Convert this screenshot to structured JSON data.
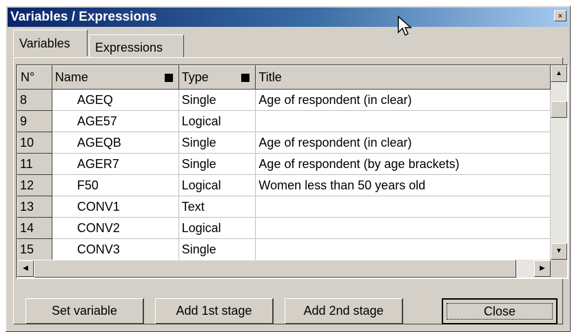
{
  "window": {
    "title": "Variables / Expressions",
    "close_glyph": "×"
  },
  "tabs": [
    {
      "label": "Variables",
      "active": true
    },
    {
      "label": "Expressions",
      "active": false
    }
  ],
  "grid": {
    "columns": [
      "N°",
      "Name",
      "Type",
      "Title"
    ],
    "rows": [
      {
        "n": "8",
        "name": "AGEQ",
        "type": "Single",
        "title": "Age of respondent  (in clear)"
      },
      {
        "n": "9",
        "name": "AGE57",
        "type": "Logical",
        "title": ""
      },
      {
        "n": "10",
        "name": "AGEQB",
        "type": "Single",
        "title": "Age of respondent  (in clear)"
      },
      {
        "n": "11",
        "name": "AGER7",
        "type": "Single",
        "title": "Age of respondent  (by age brackets)"
      },
      {
        "n": "12",
        "name": "F50",
        "type": "Logical",
        "title": "Women less than 50 years old"
      },
      {
        "n": "13",
        "name": "CONV1",
        "type": "Text",
        "title": ""
      },
      {
        "n": "14",
        "name": "CONV2",
        "type": "Logical",
        "title": ""
      },
      {
        "n": "15",
        "name": "CONV3",
        "type": "Single",
        "title": ""
      }
    ]
  },
  "scroll_glyphs": {
    "up": "▲",
    "down": "▼",
    "left": "◀",
    "right": "▶"
  },
  "buttons": {
    "set_variable": "Set variable",
    "add_1st_stage": "Add 1st stage",
    "add_2nd_stage": "Add 2nd stage",
    "close": "Close"
  },
  "colors": {
    "title_bar_start": "#0a246a",
    "title_bar_end": "#a6caf0",
    "face": "#d4d0c8"
  }
}
